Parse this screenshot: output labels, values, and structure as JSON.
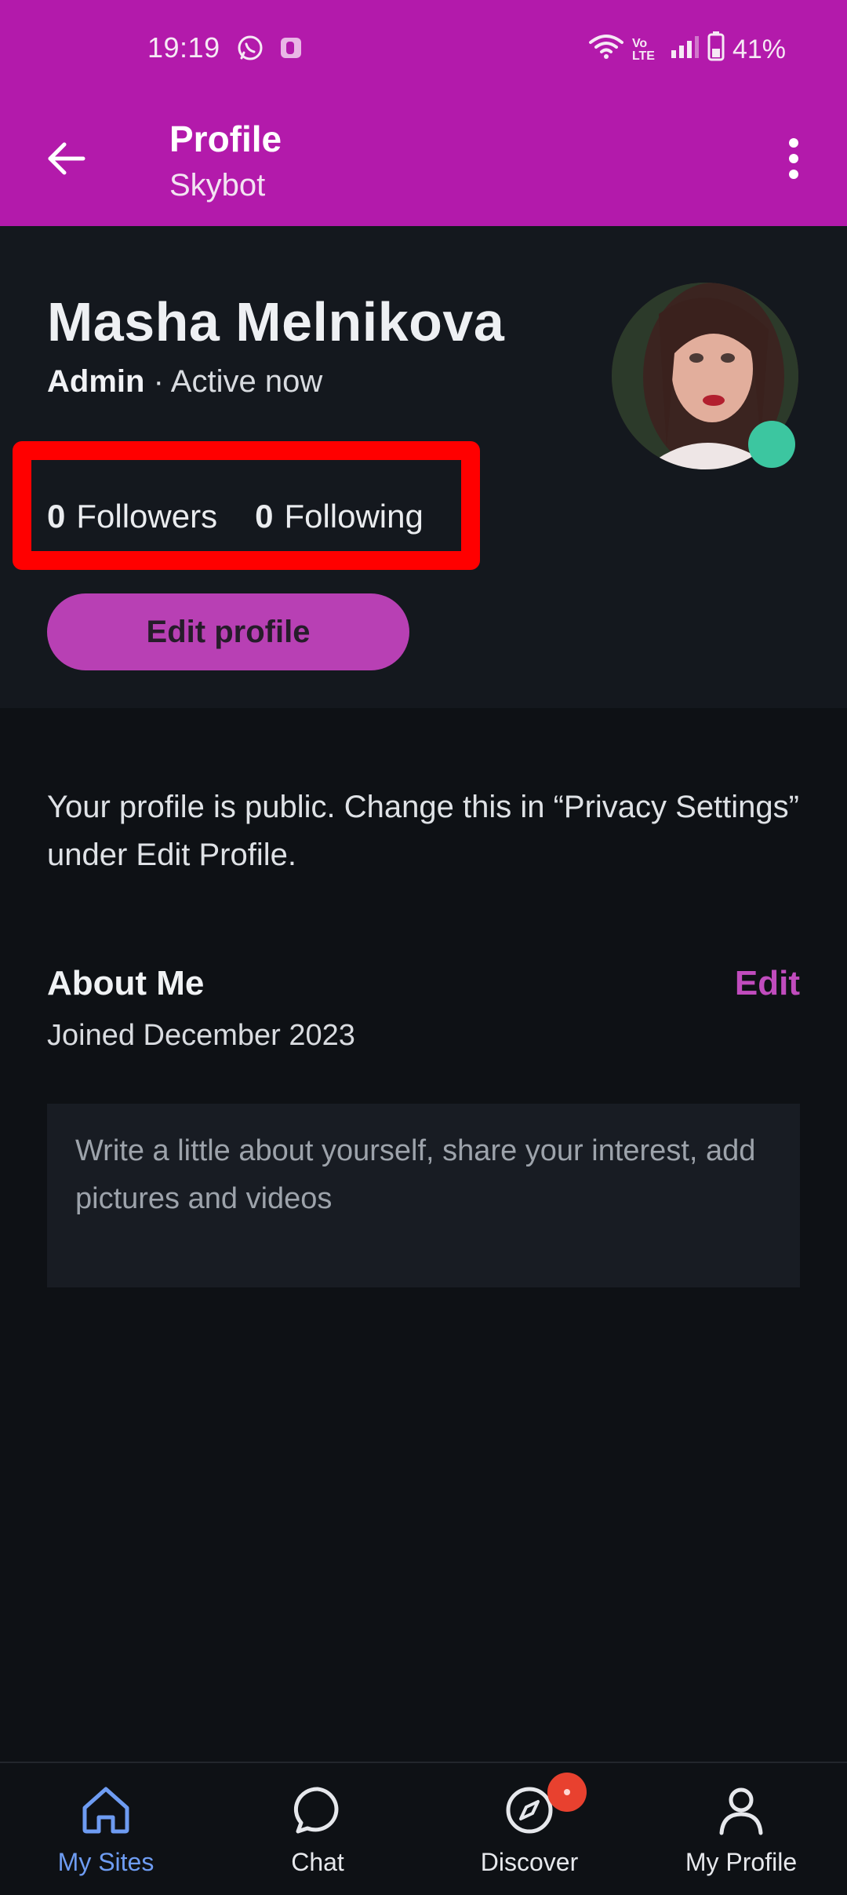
{
  "status_bar": {
    "time": "19:19",
    "battery": "41%",
    "network": "Vo LTE"
  },
  "app_bar": {
    "title": "Profile",
    "subtitle": "Skybot"
  },
  "profile": {
    "name": "Masha Melnikova",
    "role": "Admin",
    "separator": "·",
    "status": "Active now",
    "followers_count": "0",
    "followers_label": "Followers",
    "following_count": "0",
    "following_label": "Following",
    "edit_button": "Edit profile"
  },
  "privacy_note": "Your profile is public. Change this in “Privacy Settings” under Edit Profile.",
  "about": {
    "title": "About Me",
    "edit_label": "Edit",
    "joined": "Joined December 2023",
    "placeholder": "Write a little about yourself, share your interest, add pictures and videos"
  },
  "bottom_nav": {
    "items": [
      {
        "label": "My Sites",
        "icon": "home-icon",
        "active": true
      },
      {
        "label": "Chat",
        "icon": "chat-icon",
        "active": false
      },
      {
        "label": "Discover",
        "icon": "compass-icon",
        "active": false
      },
      {
        "label": "My Profile",
        "icon": "person-icon",
        "active": false
      }
    ]
  },
  "colors": {
    "app_bar": "#b31aab",
    "header_bg": "#14181e",
    "page_bg": "#0e1115",
    "accent": "#c04cbd",
    "button": "#b840b4",
    "online": "#3cc6a0",
    "active_nav": "#6e9cf2",
    "highlight_box": "#ff0000"
  }
}
